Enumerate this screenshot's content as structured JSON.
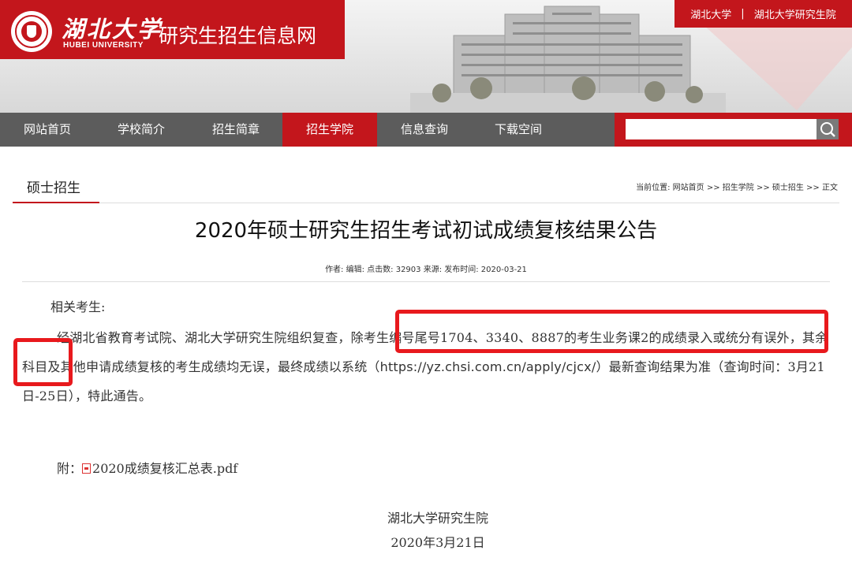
{
  "header": {
    "university_cn": "湖北大学",
    "university_en": "HUBEI UNIVERSITY",
    "site_title": "研究生招生信息网",
    "toplinks": {
      "link1": "湖北大学",
      "separator": "|",
      "link2": "湖北大学研究生院"
    }
  },
  "nav": {
    "items": [
      {
        "label": "网站首页"
      },
      {
        "label": "学校简介"
      },
      {
        "label": "招生简章"
      },
      {
        "label": "招生学院"
      },
      {
        "label": "信息查询"
      },
      {
        "label": "下载空间"
      }
    ],
    "active_index": 3,
    "search": {
      "value": "",
      "placeholder": ""
    }
  },
  "section": {
    "tab_label": "硕士招生",
    "breadcrumb": "当前位置: 网站首页 >> 招生学院 >> 硕士招生 >> 正文"
  },
  "article": {
    "title": "2020年硕士研究生招生考试初试成绩复核结果公告",
    "meta": "作者:   编辑:   点击数: 32903 来源:   发布时间: 2020-03-21",
    "greeting": "相关考生:",
    "body_part1": "经湖北省教育考试院、湖北大学研究生院组织复查，除考生编号尾号1704、3340、8887的考生业务课2的成绩录入或统分有误外，其余科目及其他申请成绩复核的考生成绩均无误，最终成绩以系统（",
    "body_url": "https://yz.chsi.com.cn/apply/cjcx/",
    "body_part2": "）最新查询结果为准（查询时间：3月21日-25日），特此通告。",
    "attachment_prefix": "附：",
    "attachment_name": "2020成绩复核汇总表.pdf",
    "signature_org": "湖北大学研究生院",
    "signature_date": "2020年3月21日"
  },
  "colors": {
    "brand_red": "#c3161c",
    "nav_gray": "#5c5c5c",
    "highlight_red": "#e8191d"
  },
  "icons": {
    "search": "search-icon",
    "logo": "university-seal-icon",
    "attachment": "pdf-file-icon"
  }
}
